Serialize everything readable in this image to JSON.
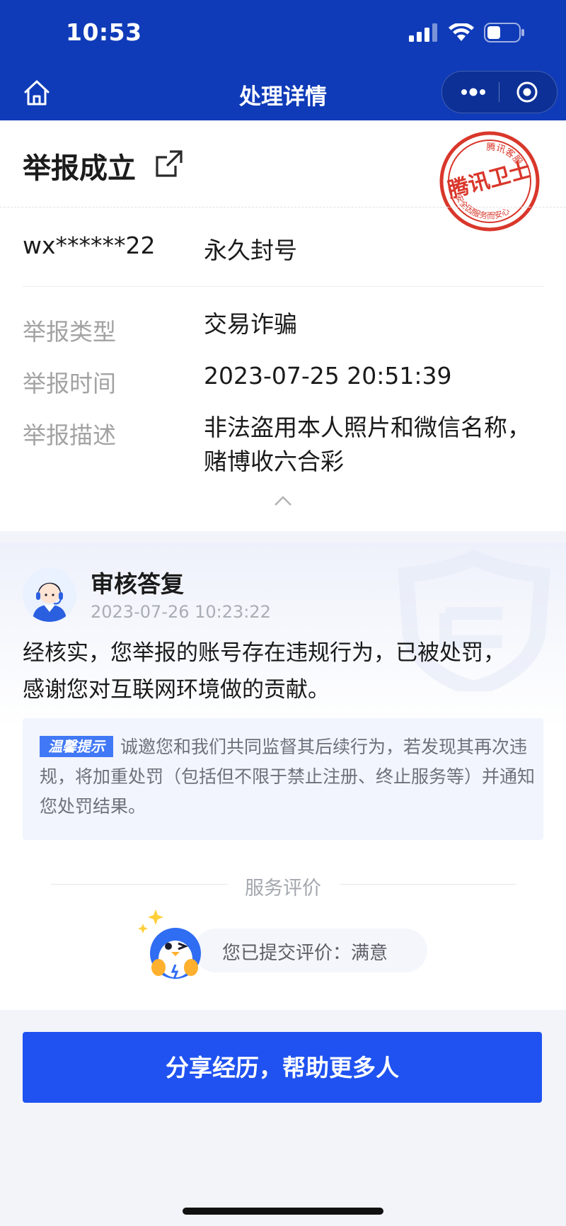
{
  "status_bar": {
    "time": "10:53"
  },
  "nav": {
    "title": "处理详情"
  },
  "report": {
    "heading": "举报成立",
    "stamp": {
      "top_text": "腾讯客服",
      "main_text": "腾讯卫士",
      "bottom_text": "安全因服务而安心"
    },
    "account": "wx******22",
    "penalty": "永久封号",
    "type_label": "举报类型",
    "type_value": "交易诈骗",
    "time_label": "举报时间",
    "time_value": "2023-07-25 20:51:39",
    "desc_label": "举报描述",
    "desc_line1": "非法盗用本人照片和微信名称，",
    "desc_line2": "赌博收六合彩"
  },
  "reply": {
    "title": "审核答复",
    "time": "2023-07-26 10:23:22",
    "text_line1": "经核实，您举报的账号存在违规行为，已被处罚，",
    "text_line2": "感谢您对互联网环境做的贡献。",
    "tip_badge": "温馨提示",
    "tip_text": "诚邀您和我们共同监督其后续行为，若发现其再次违规，将加重处罚（包括但不限于禁止注册、终止服务等）并通知您处罚结果。"
  },
  "evaluation": {
    "title": "服务评价",
    "submitted_text": "您已提交评价：满意"
  },
  "share_button": {
    "label": "分享经历，帮助更多人"
  },
  "colors": {
    "brand": "#0f3bb8",
    "button": "#1f52f0",
    "stamp": "#d9372b"
  }
}
